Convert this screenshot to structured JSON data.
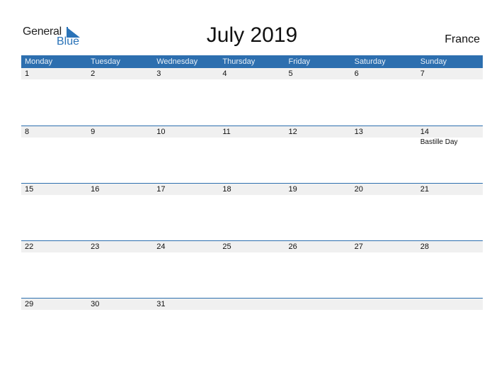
{
  "logo": {
    "line1": "General",
    "line2": "Blue"
  },
  "title": "July 2019",
  "country": "France",
  "colors": {
    "accent": "#2d6faf",
    "day_row_bg": "#f0f0f0"
  },
  "weekdays": [
    "Monday",
    "Tuesday",
    "Wednesday",
    "Thursday",
    "Friday",
    "Saturday",
    "Sunday"
  ],
  "weeks": [
    {
      "days": [
        "1",
        "2",
        "3",
        "4",
        "5",
        "6",
        "7"
      ],
      "events": [
        "",
        "",
        "",
        "",
        "",
        "",
        ""
      ]
    },
    {
      "days": [
        "8",
        "9",
        "10",
        "11",
        "12",
        "13",
        "14"
      ],
      "events": [
        "",
        "",
        "",
        "",
        "",
        "",
        "Bastille Day"
      ]
    },
    {
      "days": [
        "15",
        "16",
        "17",
        "18",
        "19",
        "20",
        "21"
      ],
      "events": [
        "",
        "",
        "",
        "",
        "",
        "",
        ""
      ]
    },
    {
      "days": [
        "22",
        "23",
        "24",
        "25",
        "26",
        "27",
        "28"
      ],
      "events": [
        "",
        "",
        "",
        "",
        "",
        "",
        ""
      ]
    },
    {
      "days": [
        "29",
        "30",
        "31",
        "",
        "",
        "",
        ""
      ],
      "events": [
        "",
        "",
        "",
        "",
        "",
        "",
        ""
      ]
    }
  ]
}
